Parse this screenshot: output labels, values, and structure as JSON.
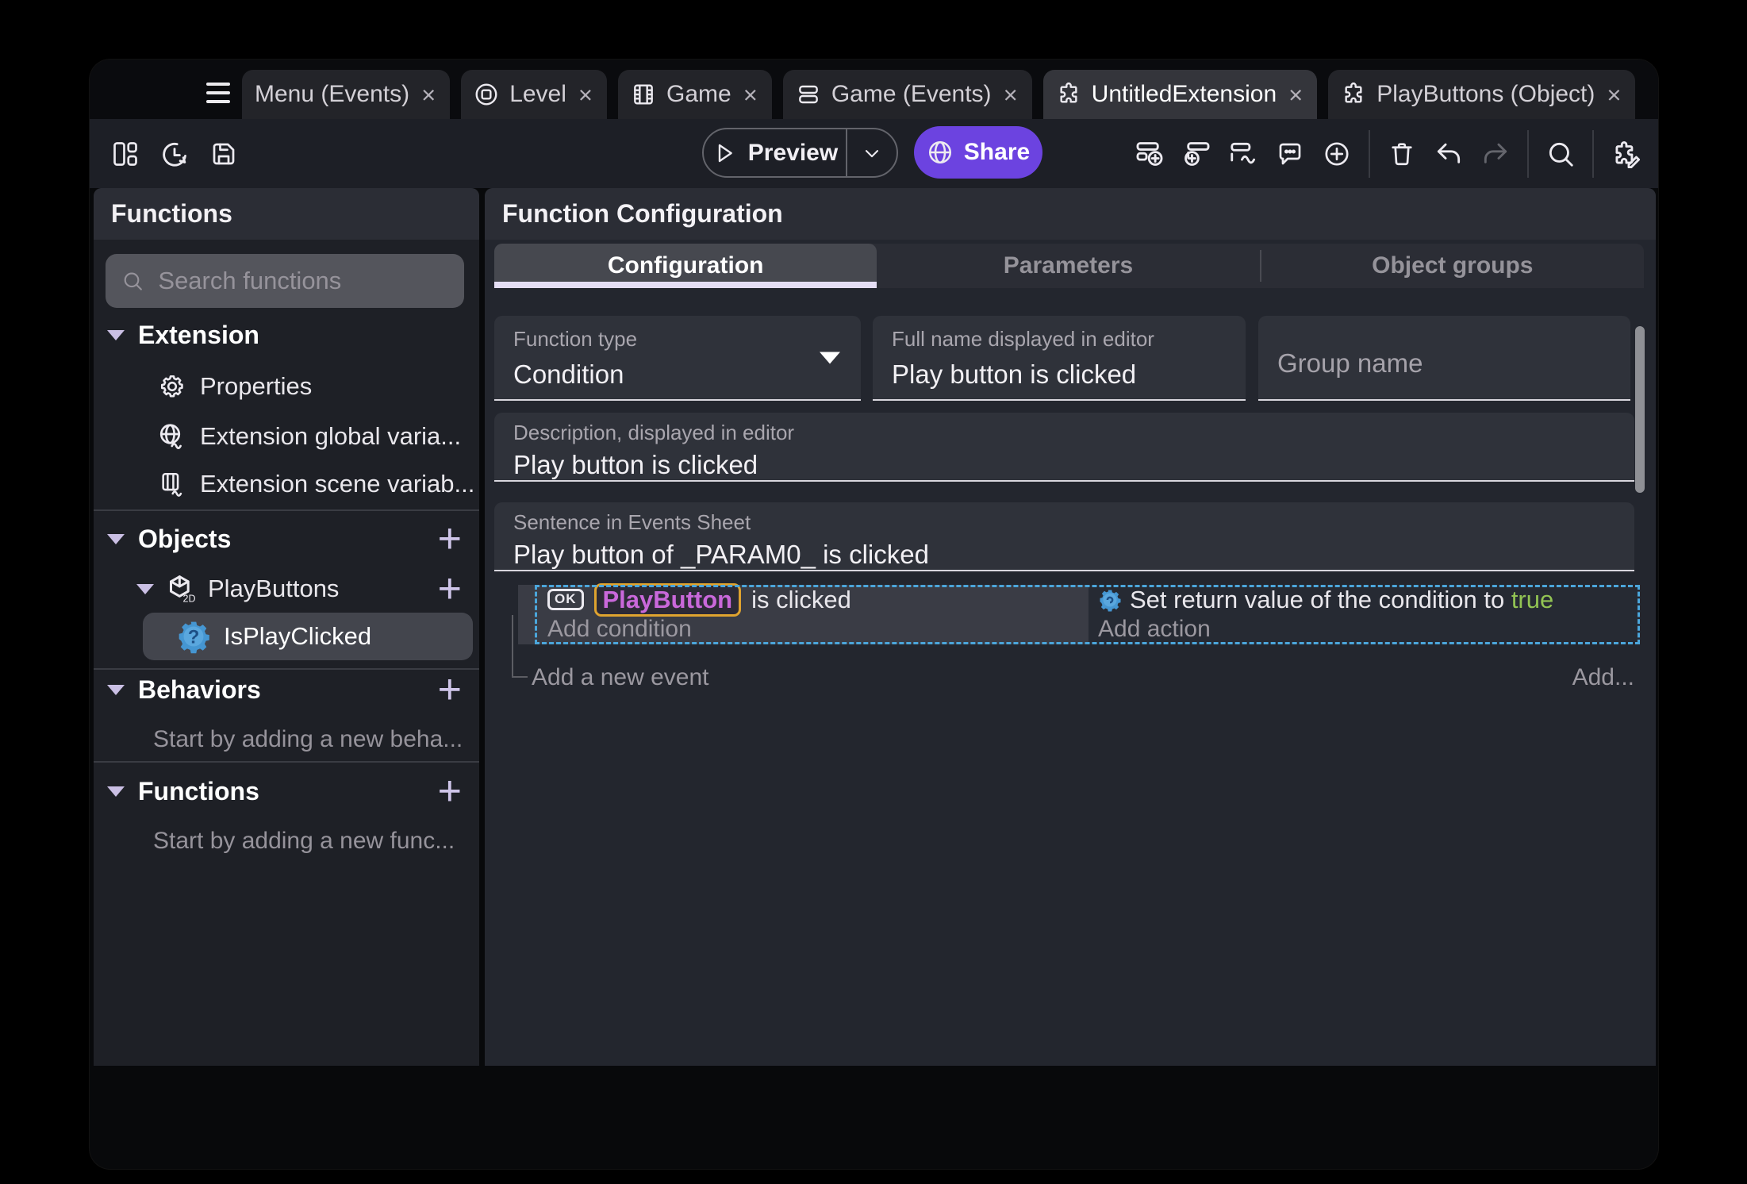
{
  "colors": {
    "accent_purple": "#6c43e0",
    "tab_underline": "#e5def5",
    "selection_dashed_blue": "#4ba6db",
    "object_param_text": "#c968da",
    "object_param_border": "#dfa32f",
    "true_green": "#92c353",
    "traffic_red": "#ff5f57",
    "traffic_yellow": "#febc2e",
    "traffic_green": "#28c840",
    "function_icon_blue": "#4596d2"
  },
  "tabbar": {
    "close_glyph": "×",
    "tabs": [
      {
        "label": "Menu (Events)"
      },
      {
        "label": "Level"
      },
      {
        "label": "Game"
      },
      {
        "label": "Game (Events)"
      },
      {
        "label": "UntitledExtension"
      },
      {
        "label": "PlayButtons (Object)"
      }
    ]
  },
  "toolbar": {
    "preview": "Preview",
    "share": "Share"
  },
  "sidebar": {
    "title": "Functions",
    "search_placeholder": "Search functions",
    "extension_section": "Extension",
    "properties": "Properties",
    "global_vars": "Extension global varia...",
    "scene_vars": "Extension scene variab...",
    "objects_section": "Objects",
    "playbuttons": "PlayButtons",
    "isplayclicked": "IsPlayClicked",
    "behaviors_section": "Behaviors",
    "behaviors_hint": "Start by adding a new beha...",
    "functions_section": "Functions",
    "functions_hint": "Start by adding a new func..."
  },
  "main": {
    "title": "Function Configuration",
    "tabs": {
      "configuration": "Configuration",
      "parameters": "Parameters",
      "object_groups": "Object groups"
    },
    "function_type": {
      "label": "Function type",
      "value": "Condition"
    },
    "full_name": {
      "label": "Full name displayed in editor",
      "value": "Play button is clicked"
    },
    "group_name_placeholder": "Group name",
    "description": {
      "label": "Description, displayed in editor",
      "value": "Play button is clicked"
    },
    "sentence": {
      "label": "Sentence in Events Sheet",
      "value": "Play button of _PARAM0_ is clicked"
    },
    "events": {
      "ok_badge": "OK",
      "condition_object": "PlayButton",
      "condition_rest": " is clicked",
      "add_condition": "Add condition",
      "action_prefix": "Set return value of the condition to ",
      "action_value": "true",
      "add_action": "Add action",
      "add_new_event": "Add a new event",
      "add_more": "Add..."
    }
  }
}
